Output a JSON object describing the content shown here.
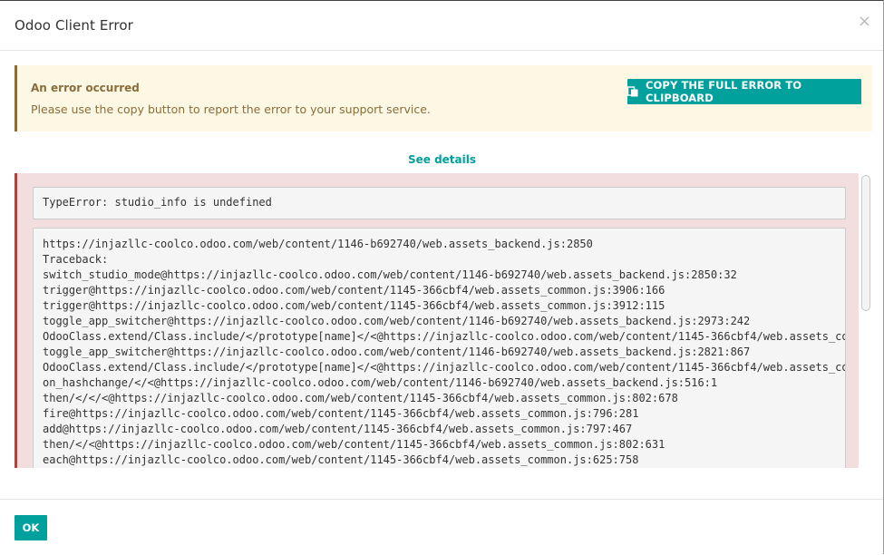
{
  "dialog": {
    "title": "Odoo Client Error",
    "close_label": "×"
  },
  "alert": {
    "title": "An error occurred",
    "message": "Please use the copy button to report the error to your support service.",
    "copy_button_label": "COPY THE FULL ERROR TO CLIPBOARD",
    "copy_icon": "clipboard-icon"
  },
  "details": {
    "toggle_label": "See details",
    "error_message": "TypeError: studio_info is undefined",
    "traceback_lines": [
      "https://injazllc-coolco.odoo.com/web/content/1146-b692740/web.assets_backend.js:2850",
      "Traceback:",
      "switch_studio_mode@https://injazllc-coolco.odoo.com/web/content/1146-b692740/web.assets_backend.js:2850:32",
      "trigger@https://injazllc-coolco.odoo.com/web/content/1145-366cbf4/web.assets_common.js:3906:166",
      "trigger@https://injazllc-coolco.odoo.com/web/content/1145-366cbf4/web.assets_common.js:3912:115",
      "toggle_app_switcher@https://injazllc-coolco.odoo.com/web/content/1146-b692740/web.assets_backend.js:2973:242",
      "OdooClass.extend/Class.include/</prototype[name]</<@https://injazllc-coolco.odoo.com/web/content/1145-366cbf4/web.assets_common",
      "toggle_app_switcher@https://injazllc-coolco.odoo.com/web/content/1146-b692740/web.assets_backend.js:2821:867",
      "OdooClass.extend/Class.include/</prototype[name]</<@https://injazllc-coolco.odoo.com/web/content/1145-366cbf4/web.assets_common",
      "on_hashchange/</<@https://injazllc-coolco.odoo.com/web/content/1146-b692740/web.assets_backend.js:516:1",
      "then/</</<@https://injazllc-coolco.odoo.com/web/content/1145-366cbf4/web.assets_common.js:802:678",
      "fire@https://injazllc-coolco.odoo.com/web/content/1145-366cbf4/web.assets_common.js:796:281",
      "add@https://injazllc-coolco.odoo.com/web/content/1145-366cbf4/web.assets_common.js:797:467",
      "then/</<@https://injazllc-coolco.odoo.com/web/content/1145-366cbf4/web.assets_common.js:802:631",
      "each@https://injazllc-coolco.odoo.com/web/content/1145-366cbf4/web.assets_common.js:625:758"
    ]
  },
  "footer": {
    "ok_label": "OK"
  },
  "colors": {
    "primary": "#00a09d",
    "warning_bg": "#fcf8e4",
    "warning_text": "#8a6d3b",
    "danger_bg": "#f2dede",
    "danger_border": "#a94442"
  }
}
